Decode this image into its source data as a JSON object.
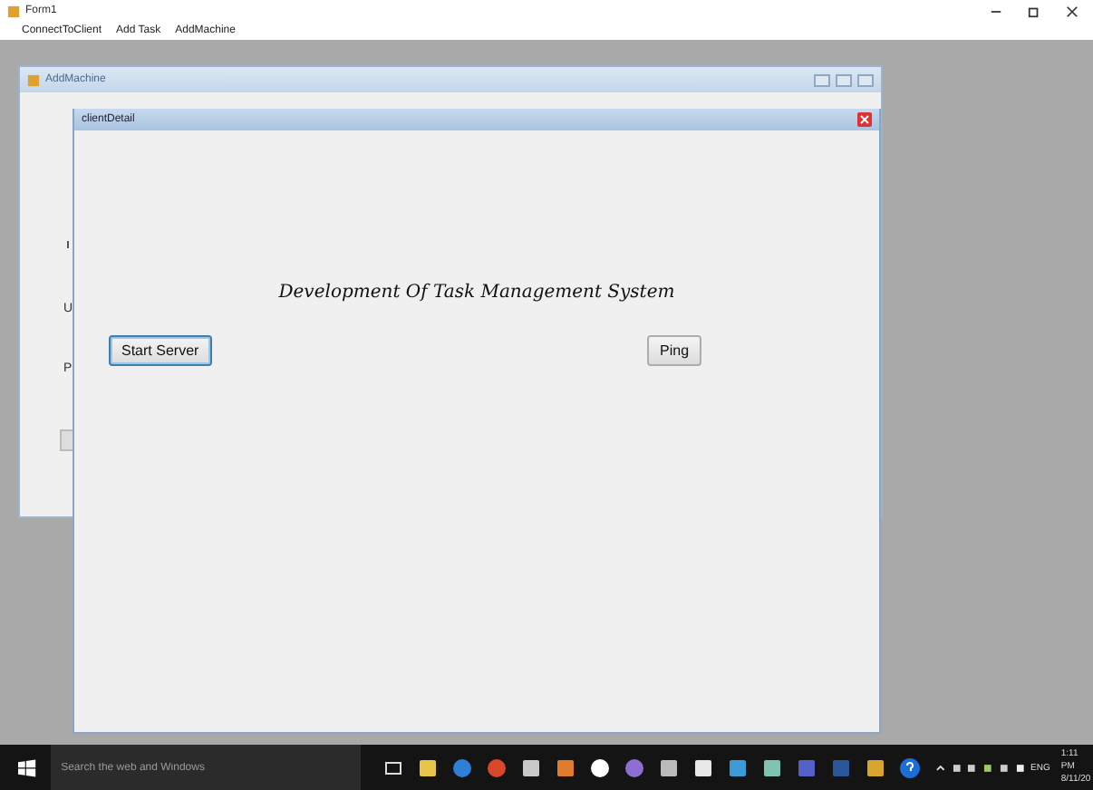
{
  "window": {
    "title": "Form1"
  },
  "menu": [
    "ConnectToClient",
    "Add Task",
    "AddMachine"
  ],
  "add_machine": {
    "title": "AddMachine",
    "partial_labels": [
      "U",
      "P"
    ]
  },
  "client_detail": {
    "title": "clientDetail",
    "heading": "Development Of Task Management System",
    "buttons": [
      {
        "label": "Start Server",
        "focused": true
      },
      {
        "label": "Ping",
        "focused": false
      }
    ]
  },
  "taskbar": {
    "search": {
      "placeholder": "Search the web and Windows"
    },
    "language": "ENG",
    "time": "1:11 PM",
    "date": "8/11/20"
  }
}
